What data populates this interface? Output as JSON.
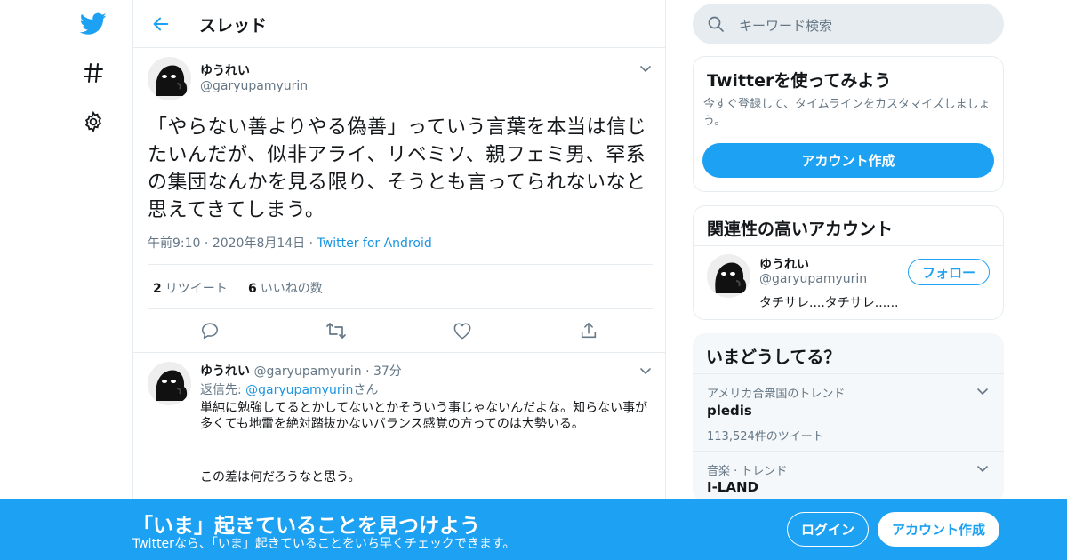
{
  "colors": {
    "accent": "#1da1f2",
    "link": "#1b95e0",
    "secondary_text": "#657786",
    "border": "#e6ecf0"
  },
  "nav": {
    "icons": [
      "twitter-logo-icon",
      "hashtag-icon",
      "gear-icon"
    ]
  },
  "header": {
    "title": "スレッド"
  },
  "main_tweet": {
    "name": "ゆうれい",
    "handle": "@garyupamyurin",
    "text": "「やらない善よりやる偽善」っていう言葉を本当は信じたいんだが、似非アライ、リベミソ、親フェミ男、罕系の集団なんかを見る限り、そうとも言ってられないなと思えてきてしまう。",
    "time": "午前9:10",
    "date": "2020年8月14日",
    "source": "Twitter for Android",
    "retweets_count": "2",
    "retweets_label": "リツイート",
    "likes_count": "6",
    "likes_label": "いいねの数"
  },
  "reply": {
    "name": "ゆうれい",
    "handle": "@garyupamyurin",
    "time": "37分",
    "replying_prefix": "返信先: ",
    "replying_handle": "@garyupamyurin",
    "replying_suffix": "さん",
    "text": "単純に勉強してるとかしてないとかそういう事じゃないんだよな。知らない事が多くても地雷を絶対踏抜かないバランス感覚の方ってのは大勢いる。",
    "text2": "この差は何だろうなと思う。"
  },
  "search": {
    "placeholder": "キーワード検索"
  },
  "signup_card": {
    "title": "Twitterを使ってみよう",
    "subtitle": "今すぐ登録して、タイムラインをカスタマイズしましょう。",
    "button": "アカウント作成"
  },
  "related": {
    "title": "関連性の高いアカウント",
    "name": "ゆうれい",
    "handle": "@garyupamyurin",
    "bio": "タチサレ....タチサレ......",
    "follow_button": "フォロー"
  },
  "trends": {
    "title": "いまどうしてる？",
    "items": [
      {
        "context": "アメリカ合衆国のトレンド",
        "name": "pledis",
        "count": "113,524件のツイート"
      },
      {
        "context": "音楽 · トレンド",
        "name": "I-LAND"
      }
    ]
  },
  "banner": {
    "title": "「いま」起きていることを見つけよう",
    "subtitle": "Twitterなら、「いま」起きていることをいち早くチェックできます。",
    "login": "ログイン",
    "signup": "アカウント作成"
  }
}
